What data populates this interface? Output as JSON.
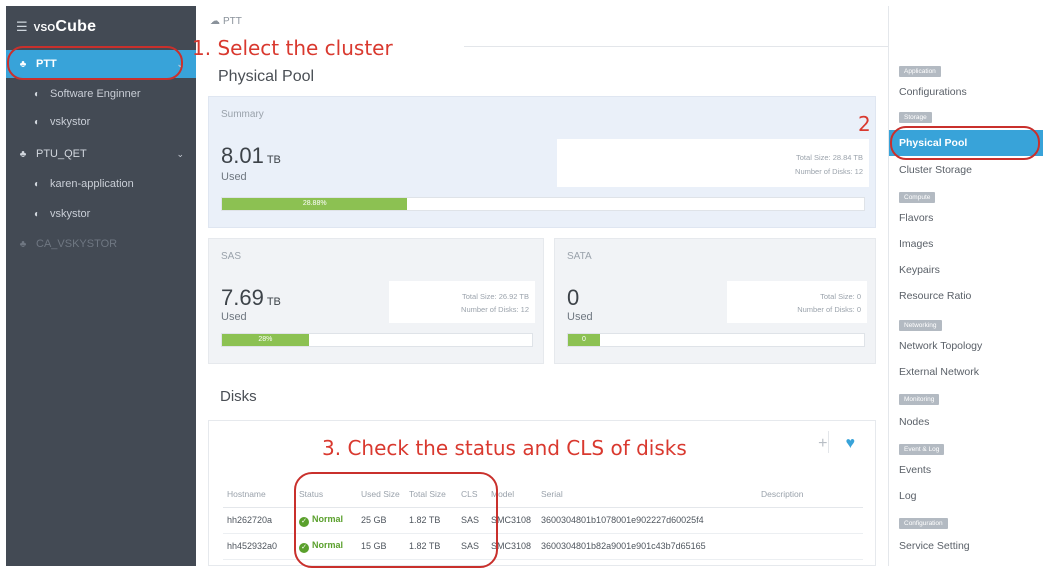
{
  "sidebar": {
    "brand": {
      "prefix": "VSO",
      "name": "Cube"
    },
    "items": [
      {
        "label": "PTT"
      },
      {
        "label": "Software Enginner"
      },
      {
        "label": "vskystor"
      },
      {
        "label": "PTU_QET"
      },
      {
        "label": "karen-application"
      },
      {
        "label": "vskystor"
      },
      {
        "label": "CA_VSKYSTOR"
      }
    ]
  },
  "breadcrumb": "PTT",
  "annotations": {
    "step1": "1. Select the cluster",
    "step2": "2",
    "step3": "3. Check the status and CLS of disks"
  },
  "page_title": "Physical Pool",
  "summary": {
    "label": "Summary",
    "value": "8.01",
    "unit": "TB",
    "used_label": "Used",
    "total_size": "Total Size: 28.84 TB",
    "num_disks": "Number of Disks: 12",
    "progress_label": "28.88%",
    "progress_fraction": 0.2888
  },
  "sas": {
    "label": "SAS",
    "value": "7.69",
    "unit": "TB",
    "used_label": "Used",
    "total_size": "Total Size: 26.92 TB",
    "num_disks": "Number of Disks: 12",
    "progress_label": "28%",
    "progress_fraction": 0.28
  },
  "sata": {
    "label": "SATA",
    "value": "0",
    "used_label": "Used",
    "total_size": "Total Size: 0",
    "num_disks": "Number of Disks: 0",
    "progress_label": "0",
    "progress_fraction": 0.0
  },
  "disks": {
    "title": "Disks",
    "columns": [
      "Hostname",
      "Status",
      "Used Size",
      "Total Size",
      "CLS",
      "Model",
      "Serial",
      "Description"
    ],
    "rows": [
      {
        "hostname": "hh262720a",
        "status": "Normal",
        "used": "25 GB",
        "total": "1.82 TB",
        "cls": "SAS",
        "model": "SMC3108",
        "serial": "3600304801b1078001e902227d60025f4",
        "description": ""
      },
      {
        "hostname": "hh452932a0",
        "status": "Normal",
        "used": "15 GB",
        "total": "1.82 TB",
        "cls": "SAS",
        "model": "SMC3108",
        "serial": "3600304801b82a9001e901c43b7d65165",
        "description": ""
      }
    ]
  },
  "right_panel": {
    "sections": [
      {
        "title": "Application",
        "items": [
          "Configurations"
        ]
      },
      {
        "title": "Storage",
        "items": [
          "Physical Pool",
          "Cluster Storage"
        ]
      },
      {
        "title": "Compute",
        "items": [
          "Flavors",
          "Images",
          "Keypairs",
          "Resource Ratio"
        ]
      },
      {
        "title": "Networking",
        "items": [
          "Network Topology",
          "External Network"
        ]
      },
      {
        "title": "Monitoring",
        "items": [
          "Nodes"
        ]
      },
      {
        "title": "Event & Log",
        "items": [
          "Events",
          "Log"
        ]
      },
      {
        "title": "Configuration",
        "items": [
          "Service Setting"
        ]
      }
    ]
  },
  "colors": {
    "sidebar_bg": "#434a54",
    "accent": "#38a3d9",
    "progress": "#8cc152",
    "annotation": "#d9392f",
    "status_ok": "#5aa02c"
  }
}
